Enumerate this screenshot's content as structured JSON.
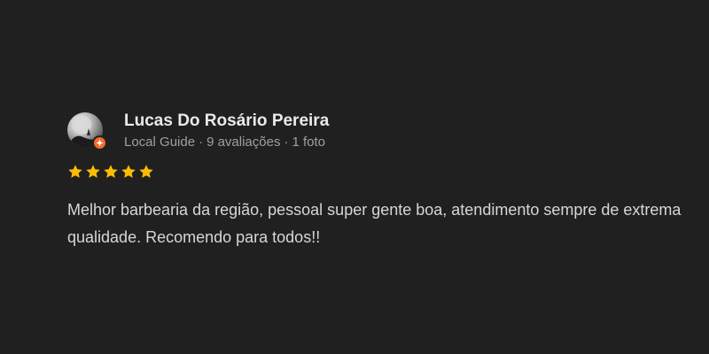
{
  "review": {
    "reviewer_name": "Lucas Do Rosário Pereira",
    "reviewer_role": "Local Guide",
    "review_count": "9 avaliações",
    "photo_count": "1 foto",
    "separator": "·",
    "rating": 5,
    "rating_max": 5,
    "text": "Melhor barbearia da região, pessoal super gente boa, atendimento sempre de extrema qualidade. Recomendo para todos!!",
    "avatar_icon": "user-avatar-photo",
    "badge_icon": "local-guide-badge-icon",
    "star_icon": "star-icon"
  },
  "colors": {
    "background": "#202020",
    "name": "#e8eaed",
    "meta": "#9aa0a6",
    "text": "#d5d7da",
    "star": "#fbbc04",
    "badge": "#f46b2e"
  }
}
